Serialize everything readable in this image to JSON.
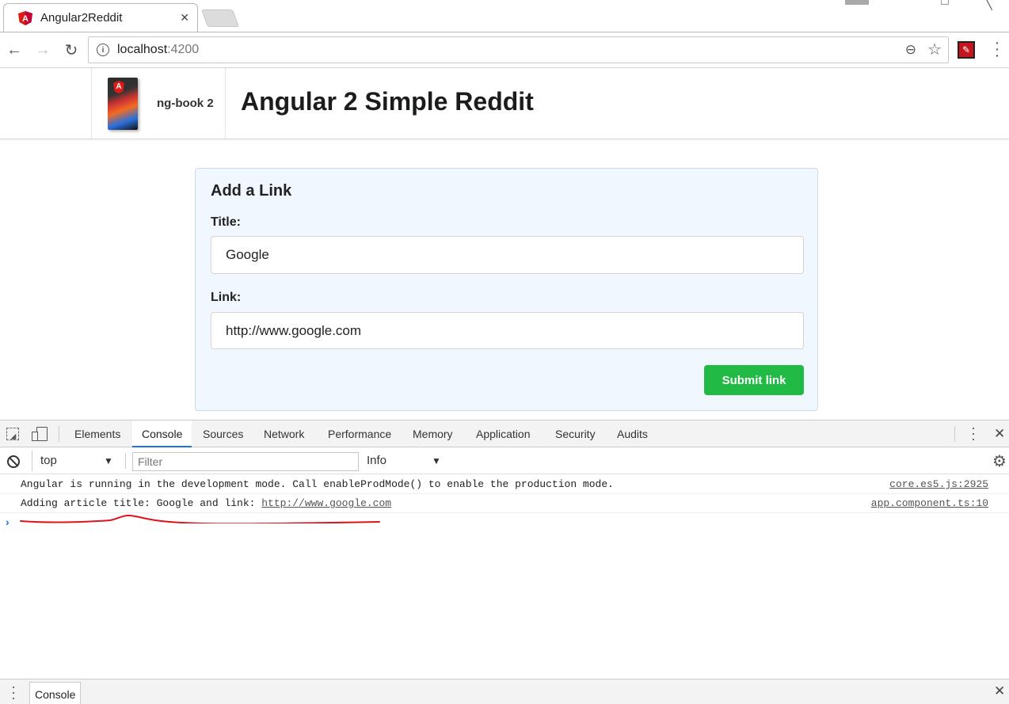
{
  "browser": {
    "tab_title": "Angular2Reddit",
    "url_host": "localhost",
    "url_port": ":4200"
  },
  "page": {
    "brand_text": "ng-book 2",
    "title": "Angular 2 Simple Reddit",
    "form": {
      "heading": "Add a Link",
      "title_label": "Title:",
      "title_value": "Google",
      "link_label": "Link:",
      "link_value": "http://www.google.com",
      "submit_label": "Submit link"
    }
  },
  "devtools": {
    "tabs": [
      "Elements",
      "Console",
      "Sources",
      "Network",
      "Performance",
      "Memory",
      "Application",
      "Security",
      "Audits"
    ],
    "active_tab": "Console",
    "context": "top",
    "filter_placeholder": "Filter",
    "level": "Info",
    "messages": [
      {
        "text": "Angular is running in the development mode. Call enableProdMode() to enable the production mode.",
        "source": "core.es5.js:2925"
      },
      {
        "text_prefix": "Adding article title: Google and link: ",
        "link": "http://www.google.com",
        "source": "app.component.ts:10"
      }
    ],
    "drawer_tab": "Console"
  },
  "colors": {
    "submit_green": "#21ba45",
    "form_bg": "#f0f7fe",
    "annotation_red": "#e0121a",
    "angular_red": "#dd1b16"
  }
}
